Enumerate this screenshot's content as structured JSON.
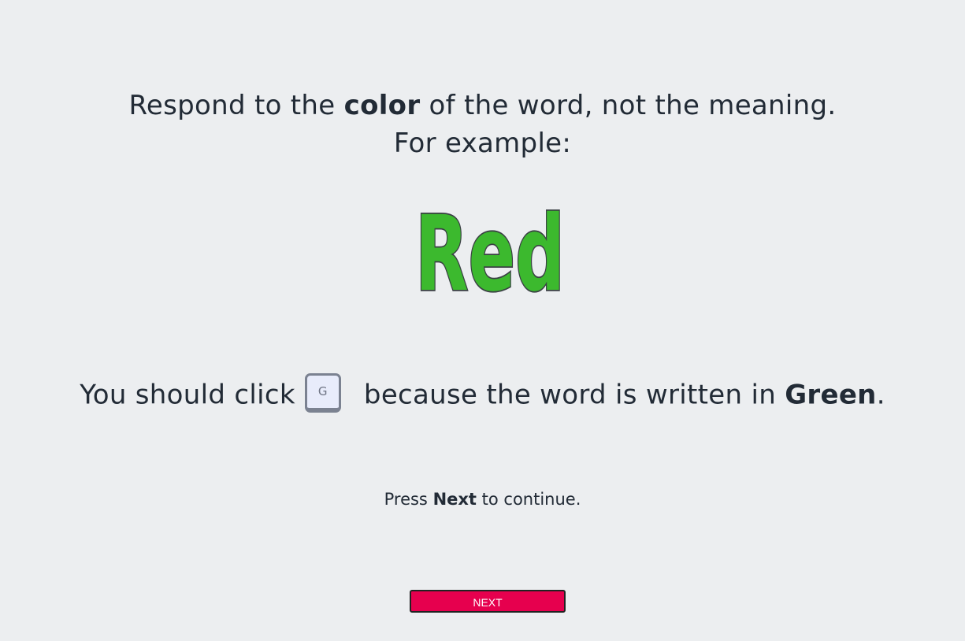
{
  "instructions": {
    "line1_pre": "Respond to the ",
    "line1_bold": "color",
    "line1_post": " of the word, not the meaning.",
    "line2": "For example:"
  },
  "stimulus": {
    "word": "Red",
    "ink_color": "#3cb92e",
    "outline_color": "#3a3f44"
  },
  "explanation": {
    "pre": "You should click",
    "key_label": "G",
    "mid": " because the word is written in ",
    "color_name": "Green",
    "post": "."
  },
  "prompt": {
    "pre": "Press ",
    "bold": "Next",
    "post": " to continue."
  },
  "next_button": {
    "label": "NEXT",
    "color": "#e6004e"
  }
}
